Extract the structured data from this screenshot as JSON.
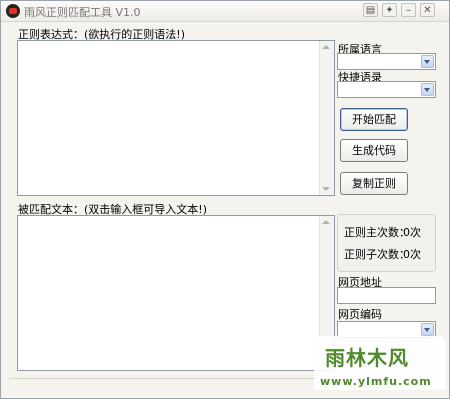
{
  "window": {
    "title": "雨风正则匹配工具 V1.0",
    "title_buttons": [
      "menu-icon",
      "settings-icon",
      "minimize-icon",
      "close-icon"
    ]
  },
  "regex": {
    "label": "正则表达式：(欲执行的正则语法!)"
  },
  "language": {
    "label": "所属语言",
    "selected": ""
  },
  "snippets": {
    "label": "快捷语录",
    "selected": ""
  },
  "buttons": {
    "start_match": "开始匹配",
    "generate_code": "生成代码",
    "copy_regex": "复制正则"
  },
  "target": {
    "label": "被匹配文本：(双击输入框可导入文本!)"
  },
  "stats": {
    "main_label": "正则主次数：",
    "main_value": "0次",
    "sub_label": "正则子次数：",
    "sub_value": "0次"
  },
  "web": {
    "url_label": "网页地址",
    "url_value": "",
    "encoding_label": "网页编码",
    "encoding_selected": ""
  },
  "watermark": {
    "text": "雨林木风",
    "url": "www.ylmfu.com"
  },
  "colors": {
    "accent": "#3b5c8c",
    "watermark": "#4f8a2c"
  }
}
